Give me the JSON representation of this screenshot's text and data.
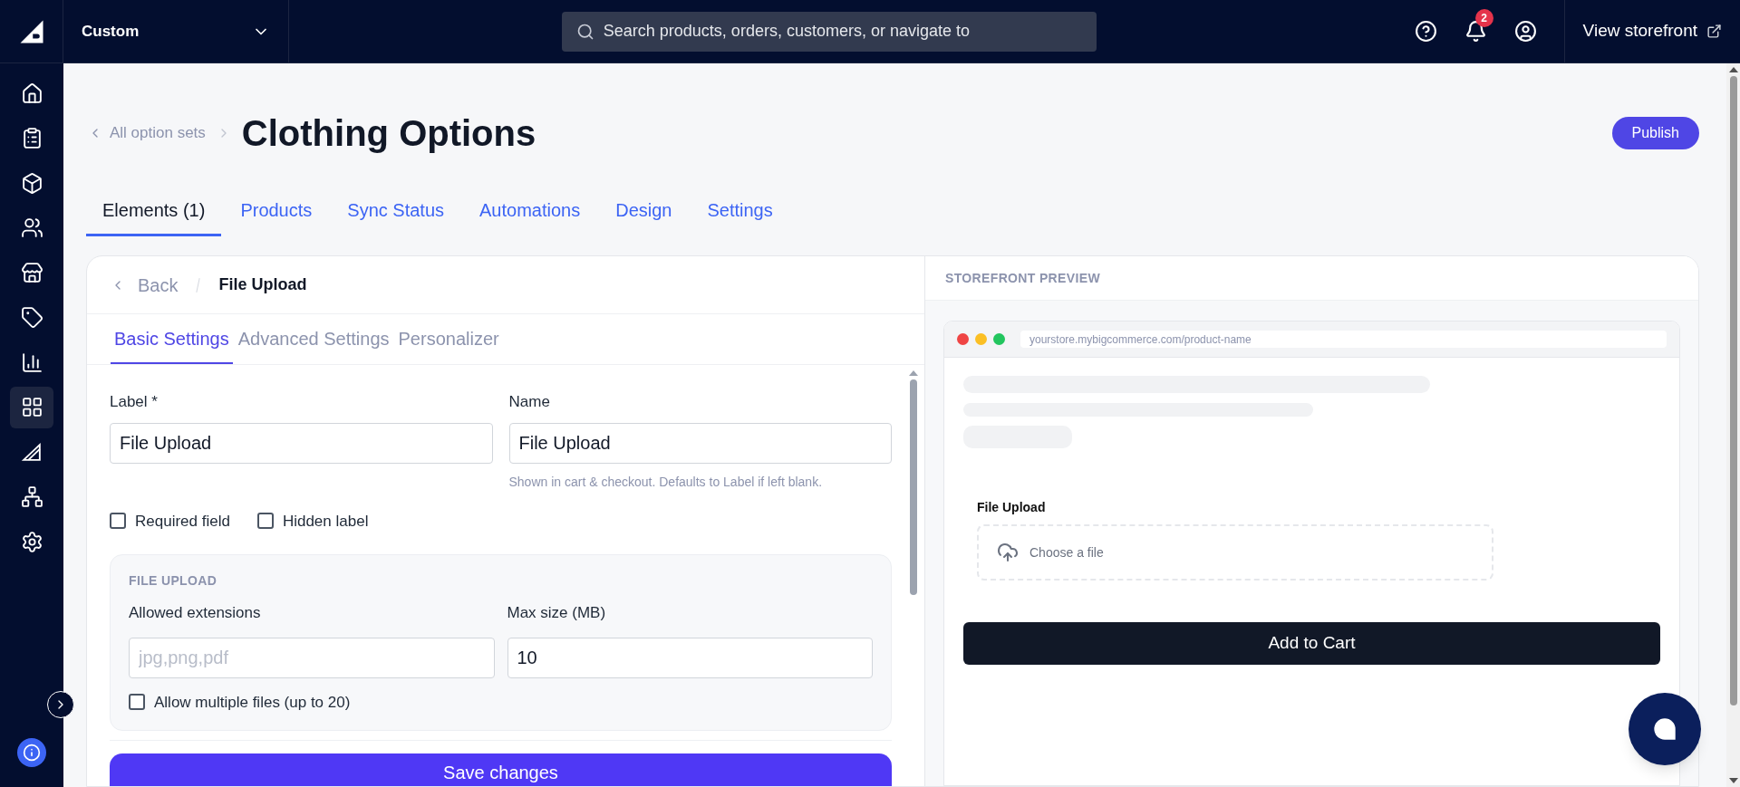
{
  "top_bar": {
    "store_selector": "Custom",
    "search": {
      "placeholder": "Search products, orders, customers, or navigate to"
    },
    "notification_count": "2",
    "view_storefront": "View storefront"
  },
  "sidebar": {
    "items": [
      {
        "selected": false
      },
      {
        "selected": false
      },
      {
        "selected": false
      },
      {
        "selected": false
      },
      {
        "selected": false
      },
      {
        "selected": false
      },
      {
        "selected": false
      },
      {
        "selected": true
      },
      {
        "selected": false
      },
      {
        "selected": false
      },
      {
        "selected": false
      }
    ]
  },
  "breadcrumb": "All option sets",
  "title": "Clothing Options",
  "publish_button": "Publish",
  "tabs": [
    {
      "label": "Elements (1)",
      "selected": true
    },
    {
      "label": "Products",
      "selected": false
    },
    {
      "label": "Sync Status",
      "selected": false
    },
    {
      "label": "Automations",
      "selected": false
    },
    {
      "label": "Design",
      "selected": false
    },
    {
      "label": "Settings",
      "selected": false
    }
  ],
  "editor": {
    "back": "Back",
    "current": "File Upload",
    "subtabs": [
      {
        "label": "Basic Settings",
        "selected": true
      },
      {
        "label": "Advanced Settings",
        "selected": false
      },
      {
        "label": "Personalizer",
        "selected": false
      }
    ],
    "label_field": {
      "label": "Label *",
      "value": "File Upload"
    },
    "name_field": {
      "label": "Name",
      "value": "File Upload",
      "hint": "Shown in cart & checkout. Defaults to Label if left blank."
    },
    "checkboxes": [
      {
        "label": "Required field",
        "checked": false
      },
      {
        "label": "Hidden label",
        "checked": false
      }
    ],
    "file_upload": {
      "heading": "FILE UPLOAD",
      "extensions": {
        "label": "Allowed extensions",
        "placeholder": "jpg,png,pdf"
      },
      "max_size": {
        "label": "Max size (MB)",
        "value": "10"
      },
      "multiple": {
        "label": "Allow multiple files (up to 20)",
        "checked": false
      }
    },
    "save_button": "Save changes"
  },
  "preview": {
    "heading": "STOREFRONT PREVIEW",
    "url": "yourstore.mybigcommerce.com/product-name",
    "field_label": "File Upload",
    "dropzone": "Choose a file",
    "add_to_cart": "Add to Cart"
  }
}
